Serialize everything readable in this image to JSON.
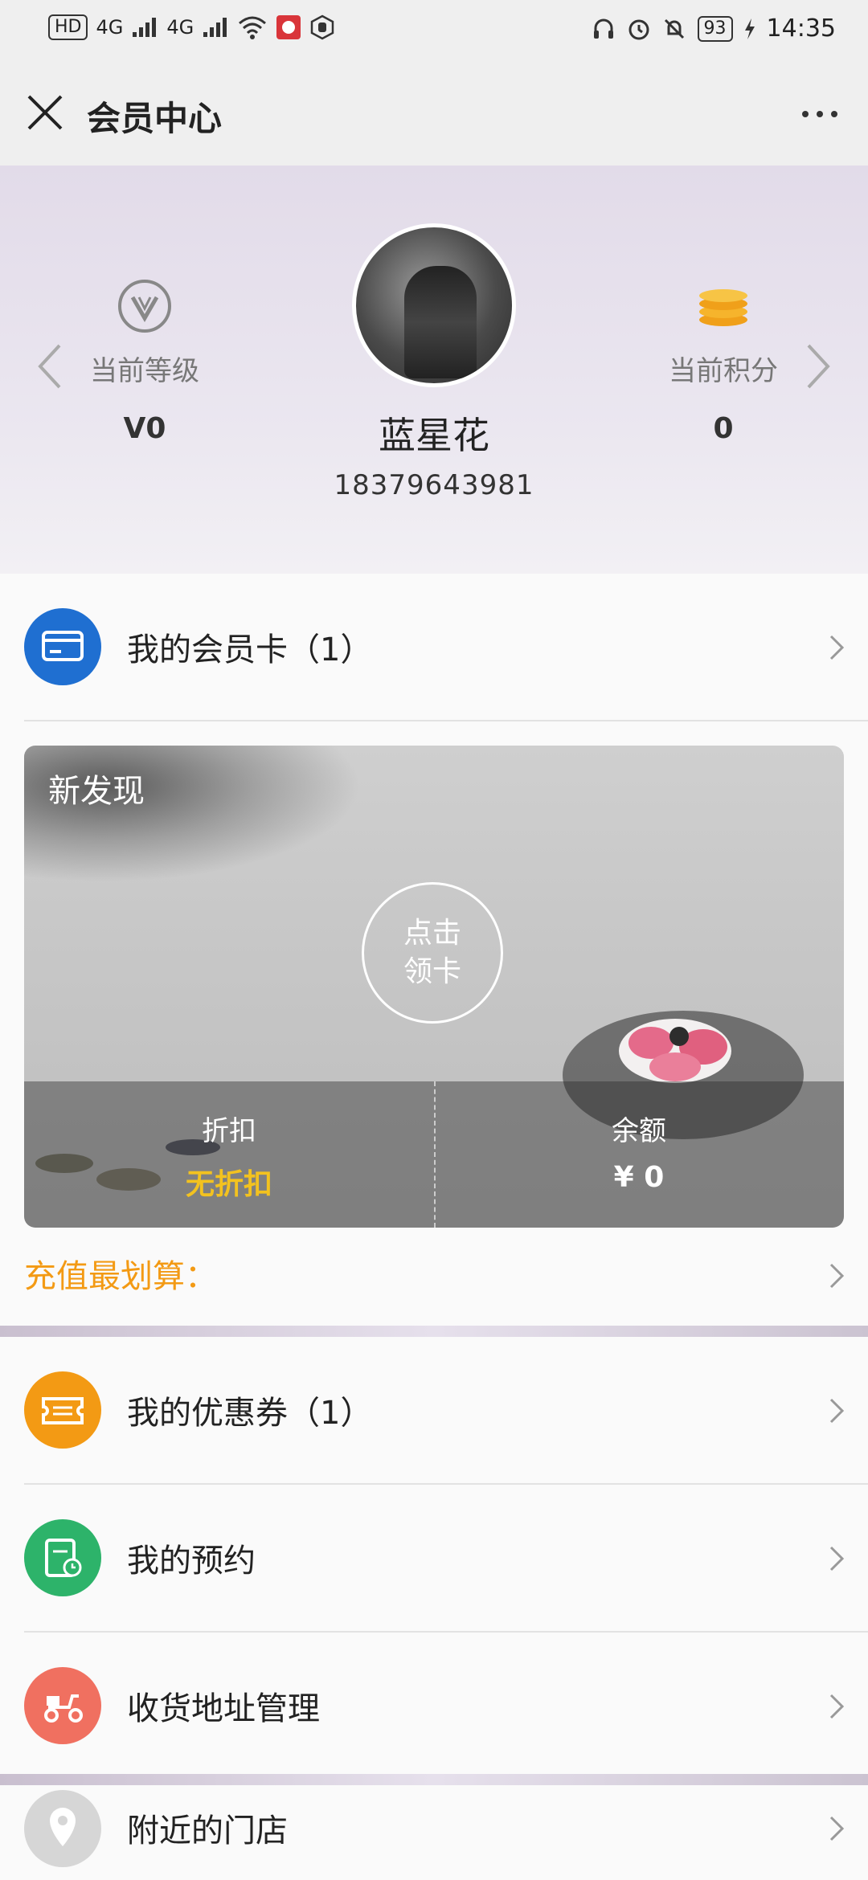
{
  "status_bar": {
    "left_badge": "HD",
    "net1": "4G",
    "net2": "4G",
    "battery": "93",
    "time": "14:35"
  },
  "title_bar": {
    "title": "会员中心"
  },
  "profile": {
    "level_label": "当前等级",
    "level_value": "V0",
    "points_label": "当前积分",
    "points_value": "0",
    "name": "蓝星花",
    "phone": "18379643981"
  },
  "menu": {
    "member_card": "我的会员卡（1）",
    "coupons": "我的优惠券（1）",
    "appointments": "我的预约",
    "address": "收货地址管理",
    "stores": "附近的门店"
  },
  "card": {
    "title": "新发现",
    "claim_line1": "点击",
    "claim_line2": "领卡",
    "discount_label": "折扣",
    "discount_value": "无折扣",
    "balance_label": "余额",
    "balance_value": "¥ 0"
  },
  "recharge_label": "充值最划算：",
  "colors": {
    "member_card_icon": "#1f6fd1",
    "coupon_icon": "#f39a14",
    "appointment_icon": "#2db36a",
    "address_icon": "#f07060",
    "store_icon": "#d6d6d6",
    "recharge_text": "#f39a14"
  }
}
